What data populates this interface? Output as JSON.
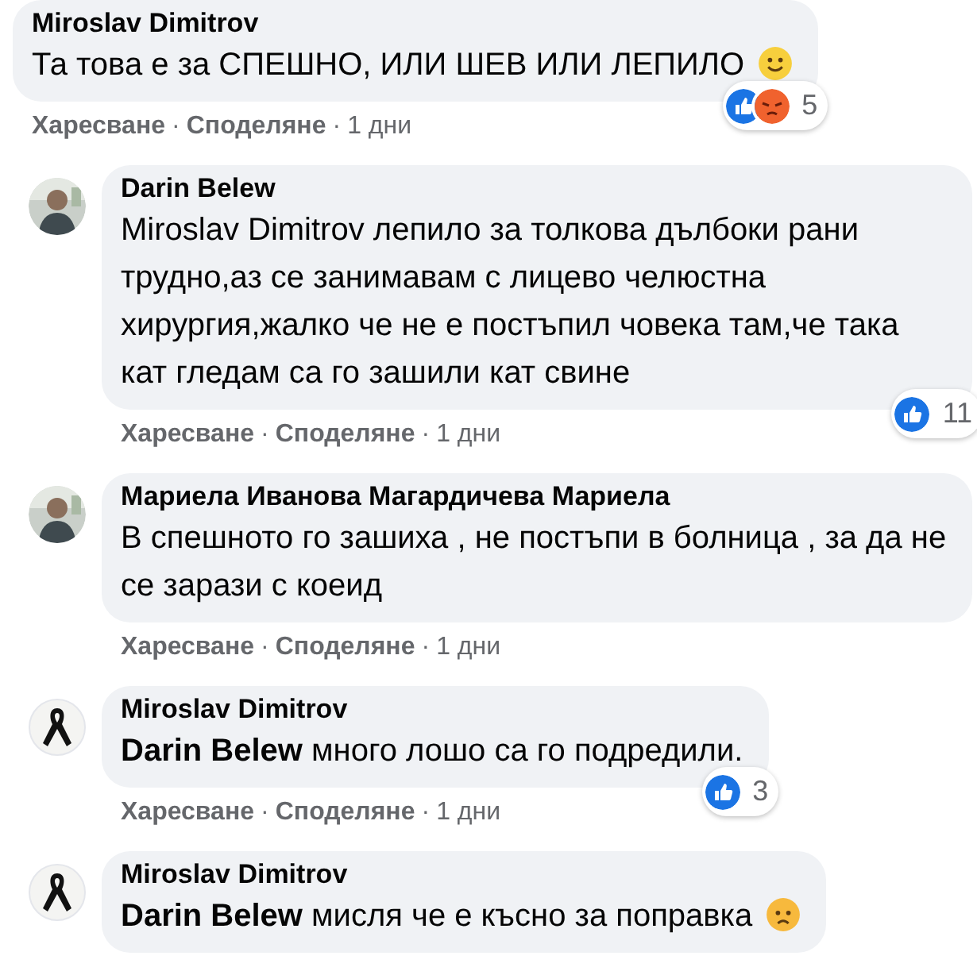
{
  "comments": [
    {
      "author": "Miroslav Dimitrov",
      "text": "Та това е за СПЕШНО, ИЛИ ШЕВ ИЛИ ЛЕПИЛО",
      "emoji": {
        "kind": "smile"
      },
      "reactions": {
        "icons": [
          {
            "kind": "like"
          },
          {
            "kind": "angry"
          }
        ],
        "count": "5"
      },
      "actions": [
        {
          "kind": "link",
          "text": "Харесване"
        },
        {
          "kind": "separator",
          "text": "·"
        },
        {
          "kind": "link",
          "text": "Споделяне"
        },
        {
          "kind": "separator",
          "text": "·"
        },
        {
          "kind": "time",
          "text": "1 дни"
        }
      ],
      "replies": [
        {
          "author": "Darin Belew",
          "text": "Miroslav Dimitrov лепило за толкова дълбоки рани трудно,аз се занимавам с лицево челюстна хирургия,жалко че не е постъпил човека там,че така кат гледам са го зашили кат свине",
          "reactions": {
            "icons": [
              {
                "kind": "like"
              }
            ],
            "count": "11"
          },
          "actions": [
            {
              "kind": "link",
              "text": "Харесване"
            },
            {
              "kind": "separator",
              "text": "·"
            },
            {
              "kind": "link",
              "text": "Споделяне"
            },
            {
              "kind": "separator",
              "text": "·"
            },
            {
              "kind": "time",
              "text": "1 дни"
            }
          ]
        },
        {
          "author": "Мариела Иванова Магардичева Мариела",
          "text": "В спешното го зашиха , не постъпи в болница , за да не се зарази с коеид",
          "actions": [
            {
              "kind": "link",
              "text": "Харесване"
            },
            {
              "kind": "separator",
              "text": "·"
            },
            {
              "kind": "link",
              "text": "Споделяне"
            },
            {
              "kind": "separator",
              "text": "·"
            },
            {
              "kind": "time",
              "text": "1 дни"
            }
          ]
        },
        {
          "author": "Miroslav Dimitrov",
          "avatar": {
            "kind": "ribbon"
          },
          "text": "**Darin Belew** много лошо са го подредили.",
          "reactions": {
            "icons": [
              {
                "kind": "like"
              }
            ],
            "count": "3"
          },
          "actions": [
            {
              "kind": "link",
              "text": "Харесване"
            },
            {
              "kind": "separator",
              "text": "·"
            },
            {
              "kind": "link",
              "text": "Споделяне"
            },
            {
              "kind": "separator",
              "text": "·"
            },
            {
              "kind": "time",
              "text": "1 дни"
            }
          ]
        },
        {
          "author": "Miroslav Dimitrov",
          "avatar": {
            "kind": "ribbon"
          },
          "text": "**Darin Belew** мисля че е късно за поправка",
          "emoji": {
            "kind": "sad"
          }
        }
      ]
    }
  ]
}
